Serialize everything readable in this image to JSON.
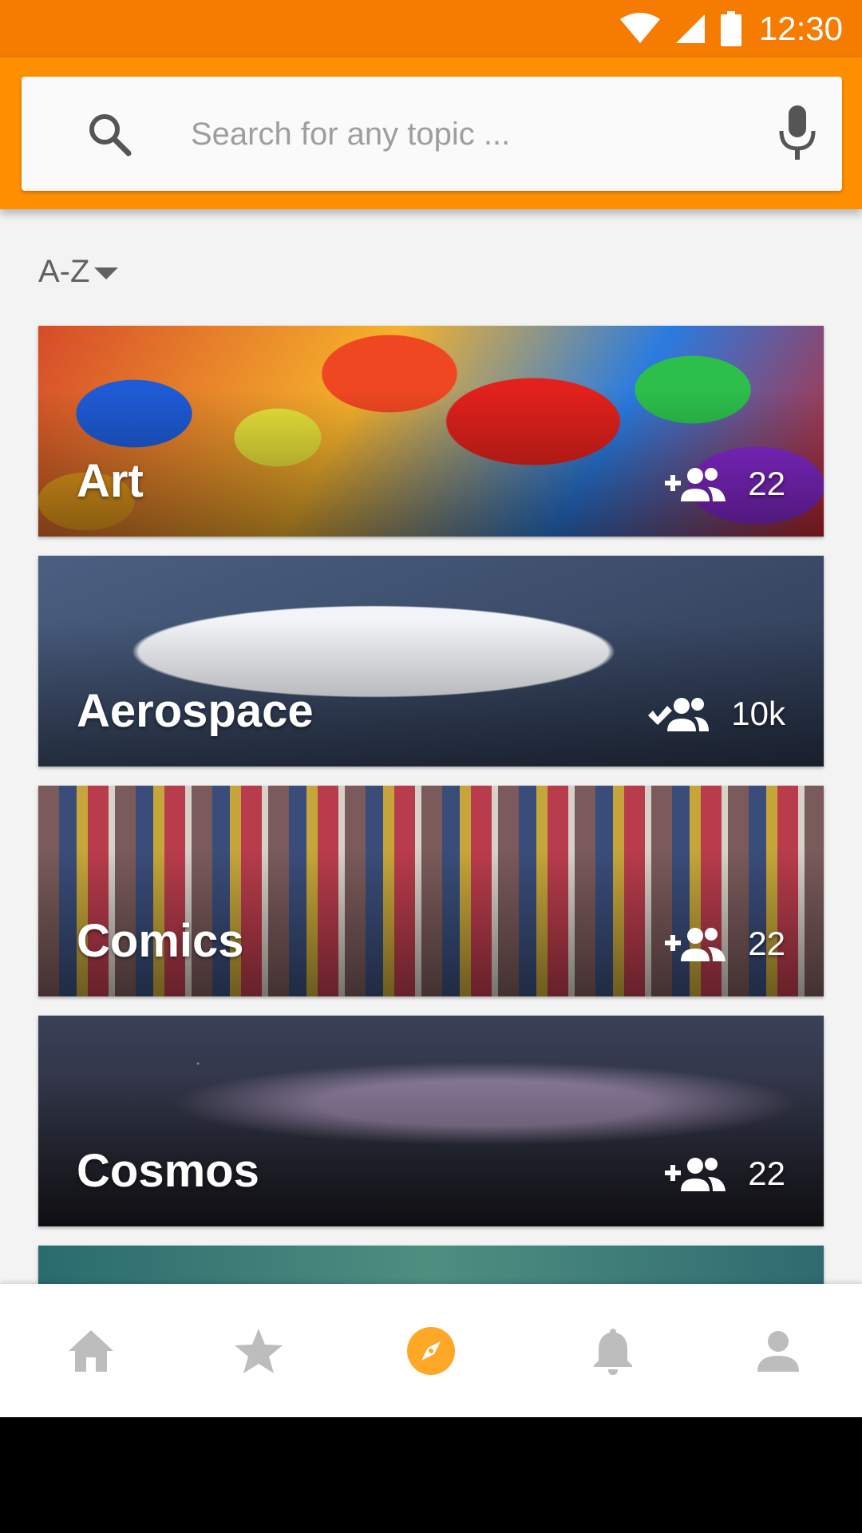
{
  "status_bar": {
    "time": "12:30",
    "icons": [
      "wifi-icon",
      "cellular-signal-icon",
      "battery-icon"
    ]
  },
  "search": {
    "placeholder": "Search for any topic ...",
    "value": ""
  },
  "sort": {
    "label": "A-Z"
  },
  "topics": [
    {
      "name": "Art",
      "count": "22",
      "action_icon": "group-add-icon"
    },
    {
      "name": "Aerospace",
      "count": "10k",
      "action_icon": "group-joined-icon"
    },
    {
      "name": "Comics",
      "count": "22",
      "action_icon": "group-add-icon"
    },
    {
      "name": "Cosmos",
      "count": "22",
      "action_icon": "group-add-icon"
    }
  ],
  "bottom_nav": {
    "items": [
      "home-icon",
      "star-icon",
      "explore-compass-icon",
      "notifications-bell-icon",
      "profile-person-icon"
    ],
    "active": "explore-compass-icon"
  },
  "colors": {
    "status_bar": "#f57c00",
    "app_bar": "#ff8f00",
    "accent": "#ffa726",
    "nav_inactive": "#bdbdbd"
  }
}
